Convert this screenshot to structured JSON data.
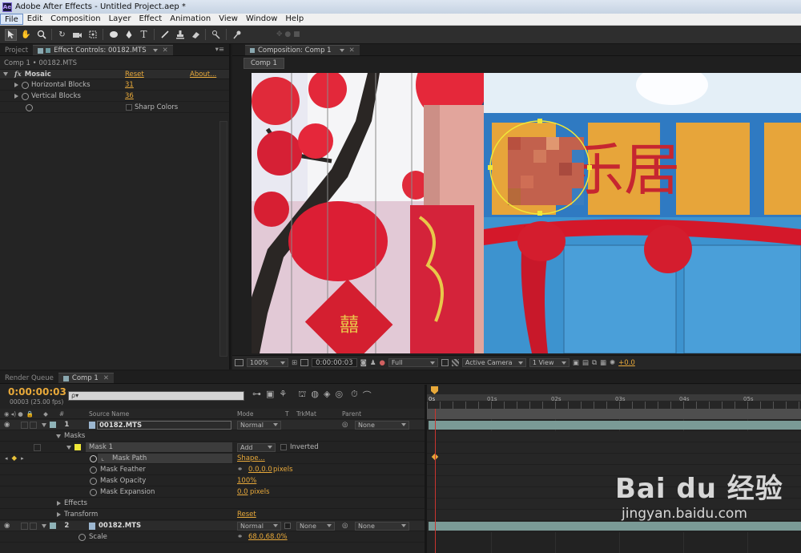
{
  "app": {
    "title": "Adobe After Effects - Untitled Project.aep *",
    "icon": "Ae"
  },
  "menu": [
    "File",
    "Edit",
    "Composition",
    "Layer",
    "Effect",
    "Animation",
    "View",
    "Window",
    "Help"
  ],
  "tools": [
    "selection-tool",
    "hand-tool",
    "zoom-tool",
    "rotate-tool",
    "camera-orbit-tool",
    "pan-behind-tool",
    "ellipse-mask-tool",
    "pen-tool",
    "text-tool",
    "brush-tool",
    "clone-stamp-tool",
    "eraser-tool",
    "roto-brush-tool",
    "puppet-pin-tool"
  ],
  "effect_panel": {
    "tab_project": "Project",
    "tab_effect": "Effect Controls: 00182.MTS",
    "breadcrumb": "Comp 1 • 00182.MTS",
    "effect_name": "Mosaic",
    "reset": "Reset",
    "about": "About...",
    "params": [
      {
        "name": "Horizontal Blocks",
        "value": "31"
      },
      {
        "name": "Vertical Blocks",
        "value": "36"
      }
    ],
    "sharp_colors": "Sharp Colors"
  },
  "comp_panel": {
    "tab": "Composition: Comp 1",
    "subtab": "Comp 1",
    "zoom": "100%",
    "timecode": "0:00:00:03",
    "resolution": "Full",
    "camera": "Active Camera",
    "views": "1 View",
    "exposure": "+0.0",
    "sign_text": "乐居"
  },
  "timeline": {
    "tab_render": "Render Queue",
    "tab_comp": "Comp 1",
    "timecode": "0:00:00:03",
    "frame_info": "00003 (25.00 fps)",
    "search_placeholder": "ρ▾",
    "columns": {
      "num": "#",
      "source": "Source Name",
      "mode": "Mode",
      "t": "T",
      "trkmat": "TrkMat",
      "parent": "Parent"
    },
    "ruler": [
      "0s",
      "01s",
      "02s",
      "03s",
      "04s",
      "05s"
    ],
    "layer1": {
      "num": "1",
      "name": "00182.MTS",
      "mode": "Normal",
      "parent": "None"
    },
    "masks_label": "Masks",
    "mask1": {
      "name": "Mask 1",
      "mode": "Add",
      "inverted": "Inverted"
    },
    "mask_props": [
      {
        "name": "Mask Path",
        "value": "Shape..."
      },
      {
        "name": "Mask Feather",
        "value": "0.0,0.0",
        "unit": "pixels"
      },
      {
        "name": "Mask Opacity",
        "value": "100%",
        "unit": ""
      },
      {
        "name": "Mask Expansion",
        "value": "0.0",
        "unit": "pixels"
      }
    ],
    "effects_label": "Effects",
    "transform_label": "Transform",
    "transform_reset": "Reset",
    "layer2": {
      "num": "2",
      "name": "00182.MTS",
      "mode": "Normal",
      "trkmat": "None",
      "parent": "None"
    },
    "scale": {
      "name": "Scale",
      "value": "68.0,68.0%"
    }
  },
  "watermark": {
    "brand": "Bai du 经验",
    "url": "jingyan.baidu.com"
  },
  "colors": {
    "accent": "#e8a93a",
    "playhead": "#c9352f",
    "mask": "#f0e838",
    "layer_bar": "#7a9a96"
  }
}
